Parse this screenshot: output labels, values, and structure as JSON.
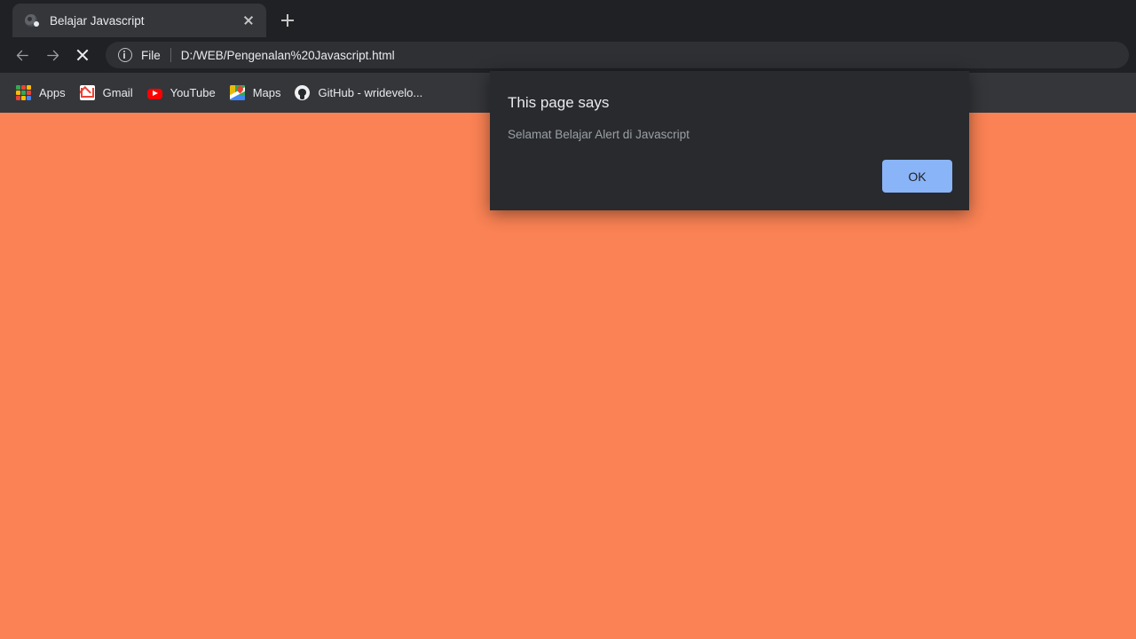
{
  "browser": {
    "tab": {
      "title": "Belajar Javascript",
      "favicon_icon": "globe-default-favicon-icon",
      "close_icon": "close-icon"
    },
    "new_tab_icon": "plus-icon",
    "nav": {
      "back_icon": "arrow-left-icon",
      "forward_icon": "arrow-right-icon",
      "stop_icon": "close-stop-loading-icon"
    },
    "omnibox": {
      "info_icon": "info-circle-icon",
      "scheme_label": "File",
      "url": "D:/WEB/Pengenalan%20Javascript.html"
    },
    "bookmarks": [
      {
        "label": "Apps",
        "icon": "apps-grid-icon"
      },
      {
        "label": "Gmail",
        "icon": "gmail-icon"
      },
      {
        "label": "YouTube",
        "icon": "youtube-icon"
      },
      {
        "label": "Maps",
        "icon": "google-maps-icon"
      },
      {
        "label": "GitHub - wridevelo...",
        "icon": "github-icon"
      }
    ]
  },
  "page": {
    "background_color": "#fa8254"
  },
  "dialog": {
    "title": "This page says",
    "message": "Selamat Belajar Alert di Javascript",
    "ok_label": "OK",
    "accent_color": "#8ab4f8",
    "background_color": "#292a2d"
  }
}
